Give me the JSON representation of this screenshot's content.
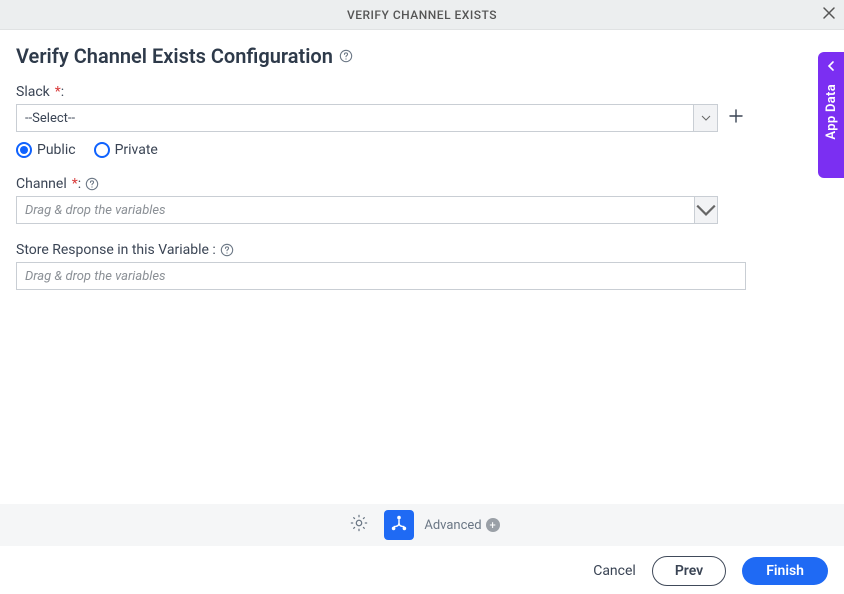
{
  "titlebar": {
    "title": "VERIFY CHANNEL EXISTS"
  },
  "page": {
    "heading": "Verify Channel Exists Configuration"
  },
  "fields": {
    "slack": {
      "label": "Slack",
      "required_marker": "*",
      "colon": ":",
      "selected": "--Select--"
    },
    "visibility": {
      "public": "Public",
      "private": "Private"
    },
    "channel": {
      "label": "Channel",
      "required_marker": "*",
      "colon": ":",
      "placeholder": "Drag & drop the variables",
      "value": ""
    },
    "store": {
      "label": "Store Response in this Variable :",
      "placeholder": "Drag & drop the variables",
      "value": ""
    }
  },
  "toolbar": {
    "advanced": "Advanced"
  },
  "buttons": {
    "cancel": "Cancel",
    "prev": "Prev",
    "finish": "Finish"
  },
  "sidetab": {
    "label": "App Data"
  }
}
